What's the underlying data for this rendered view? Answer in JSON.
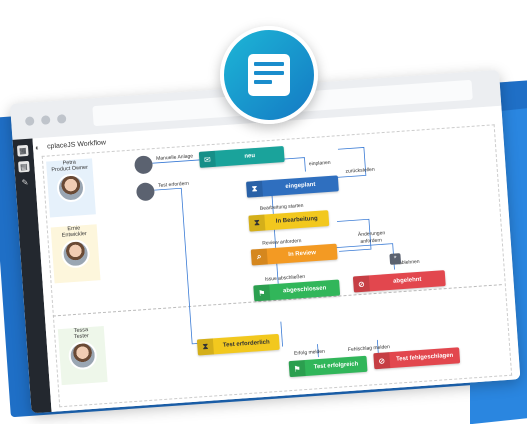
{
  "app": {
    "title": "cplaceJS Workflow"
  },
  "colors": {
    "brand": "#1479c4",
    "teal": "#1aa39b",
    "blue": "#2f6fbf",
    "yellow": "#f2c81e",
    "orange": "#f39a23",
    "green": "#31b65a",
    "red": "#e2474e"
  },
  "badge": {
    "icon": "form-card-icon"
  },
  "sidebar": {
    "icons": [
      "grid-icon",
      "document-icon",
      "wrench-icon"
    ]
  },
  "people": [
    {
      "name": "Petra",
      "role": "Product Owner"
    },
    {
      "name": "Ernie",
      "role": "Entwickler"
    },
    {
      "name": "Tessa",
      "role": "Tester"
    }
  ],
  "nodes": {
    "neu": "neu",
    "eingeplant": "eingeplant",
    "in_bearbeitung": "In Bearbeitung",
    "in_review": "In Review",
    "abgeschlossen": "abgeschlossen",
    "abgelehnt": "abgelehnt",
    "test_erforderlich": "Test erforderlich",
    "test_erfolgreich": "Test erfolgreich",
    "test_fehlgeschlagen": "Test fehlgeschlagen"
  },
  "edges": {
    "manuelle_anlage": "Manuelle Anlage",
    "einplanen": "einplanen",
    "zurueckstellen": "zurückstellen",
    "test_erfordern": "Test erfordern",
    "bearbeitung_starten": "Bearbeitung starten",
    "review_anfordern": "Review anfordern",
    "aenderungen_1": "Änderungen",
    "aenderungen_2": "anfordern",
    "ablehnen": "ablehnen",
    "issue_abschliessen": "Issue abschließen",
    "erfolg_melden": "Erfolg melden",
    "fehlschlag_melden": "Fehlschlag melden"
  }
}
